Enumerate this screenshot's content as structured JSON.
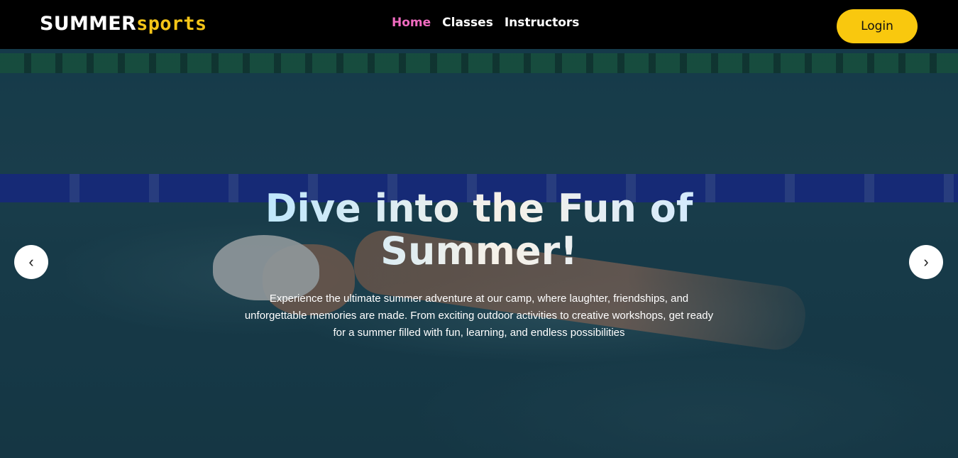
{
  "brand": {
    "part1": "SUMMER",
    "part2": "sports"
  },
  "nav": {
    "items": [
      {
        "label": "Home",
        "active": true
      },
      {
        "label": "Classes",
        "active": false
      },
      {
        "label": "Instructors",
        "active": false
      }
    ],
    "login_label": "Login"
  },
  "hero": {
    "title": "Dive into the Fun of Summer!",
    "description": "Experience the ultimate summer adventure at our camp, where laughter, friendships, and unforgettable memories are made. From exciting outdoor activities to creative workshops, get ready for a summer filled with fun, learning, and endless possibilities"
  },
  "carousel": {
    "prev_icon": "‹",
    "next_icon": "›"
  },
  "colors": {
    "accent_yellow": "#f9c80e",
    "nav_active": "#f06bc0",
    "navbar_bg": "#000000"
  }
}
